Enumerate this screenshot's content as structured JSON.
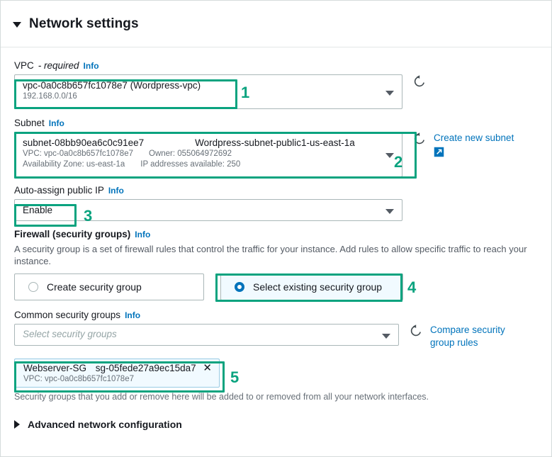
{
  "panel": {
    "title": "Network settings",
    "collapse_icon": "caret-down-icon"
  },
  "vpc": {
    "label": "VPC",
    "required_text": "- required",
    "info": "Info",
    "value": "vpc-0a0c8b657fc1078e7 (Wordpress-vpc)",
    "cidr": "192.168.0.0/16",
    "refresh_icon": "refresh-icon"
  },
  "subnet": {
    "label": "Subnet",
    "info": "Info",
    "id": "subnet-08bb90ea6c0c91ee7",
    "name": "Wordpress-subnet-public1-us-east-1a",
    "vpc_meta": "VPC: vpc-0a0c8b657fc1078e7",
    "owner_meta": "Owner: 055064972692",
    "az_meta": "Availability Zone: us-east-1a",
    "ip_meta": "IP addresses available: 250",
    "refresh_icon": "refresh-icon",
    "create_link": "Create new subnet",
    "external_link_icon": "external-link-icon"
  },
  "auto_assign_ip": {
    "label": "Auto-assign public IP",
    "info": "Info",
    "value": "Enable"
  },
  "firewall": {
    "label": "Firewall (security groups)",
    "info": "Info",
    "description": "A security group is a set of firewall rules that control the traffic for your instance. Add rules to allow specific traffic to reach your instance.",
    "options": [
      {
        "label": "Create security group",
        "selected": false
      },
      {
        "label": "Select existing security group",
        "selected": true
      }
    ]
  },
  "common_security_groups": {
    "label": "Common security groups",
    "info": "Info",
    "placeholder": "Select security groups",
    "refresh_icon": "refresh-icon",
    "compare_link_line1": "Compare security",
    "compare_link_line2": "group rules",
    "selected_group": {
      "name": "Webserver-SG",
      "id": "sg-05fede27a9ec15da7",
      "vpc": "VPC: vpc-0a0c8b657fc1078e7",
      "remove_icon": "close-icon"
    },
    "helper_text": "Security groups that you add or remove here will be added to or removed from all your network interfaces."
  },
  "advanced": {
    "label": "Advanced network configuration",
    "expand_icon": "caret-right-icon"
  },
  "annotations": {
    "marker_color": "#0aa37f",
    "markers": [
      {
        "number": "1"
      },
      {
        "number": "2"
      },
      {
        "number": "3"
      },
      {
        "number": "4"
      },
      {
        "number": "5"
      }
    ]
  }
}
